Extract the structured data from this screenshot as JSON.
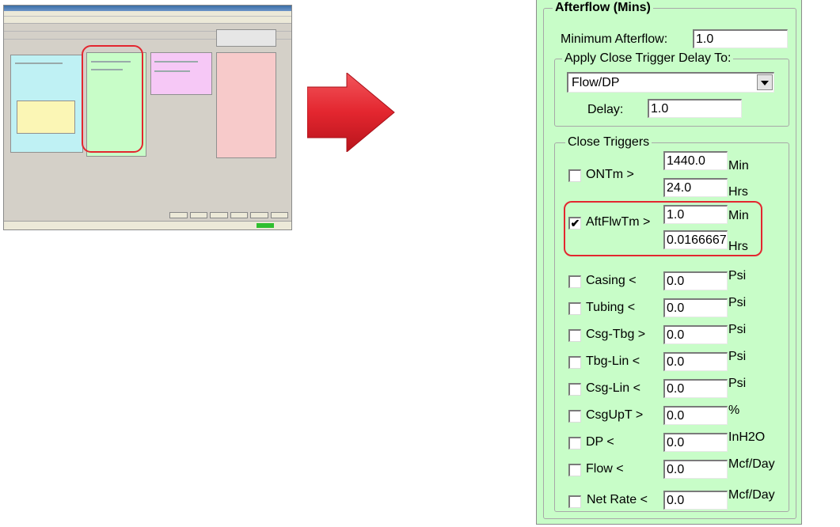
{
  "afterflow": {
    "title": "Afterflow (Mins)",
    "min_afterflow_label": "Minimum Afterflow:",
    "min_afterflow_value": "1.0",
    "apply_delay_title": "Apply Close Trigger Delay To:",
    "apply_delay_selected": "Flow/DP",
    "delay_label": "Delay:",
    "delay_value": "1.0"
  },
  "close_triggers": {
    "title": "Close Triggers",
    "rows": [
      {
        "label": "ONTm >",
        "checked": false,
        "value": "1440.0",
        "unit": "Min",
        "value2": "24.0",
        "unit2": "Hrs"
      },
      {
        "label": "AftFlwTm >",
        "checked": true,
        "value": "1.0",
        "unit": "Min",
        "value2": "0.0166667",
        "unit2": "Hrs"
      },
      {
        "label": "Casing <",
        "checked": false,
        "value": "0.0",
        "unit": "Psi"
      },
      {
        "label": "Tubing <",
        "checked": false,
        "value": "0.0",
        "unit": "Psi"
      },
      {
        "label": "Csg-Tbg >",
        "checked": false,
        "value": "0.0",
        "unit": "Psi"
      },
      {
        "label": "Tbg-Lin <",
        "checked": false,
        "value": "0.0",
        "unit": "Psi"
      },
      {
        "label": "Csg-Lin <",
        "checked": false,
        "value": "0.0",
        "unit": "Psi"
      },
      {
        "label": "CsgUpT >",
        "checked": false,
        "value": "0.0",
        "unit": "%"
      },
      {
        "label": "DP <",
        "checked": false,
        "value": "0.0",
        "unit": "InH2O"
      },
      {
        "label": "Flow <",
        "checked": false,
        "value": "0.0",
        "unit": "Mcf/Day"
      },
      {
        "label": "Net Rate <",
        "checked": false,
        "value": "0.0",
        "unit": "Mcf/Day"
      }
    ]
  },
  "check_mark": "✔",
  "colors": {
    "panel_bg": "#c8fdc8",
    "highlight": "#e3262f",
    "arrow": "#e3262f"
  }
}
